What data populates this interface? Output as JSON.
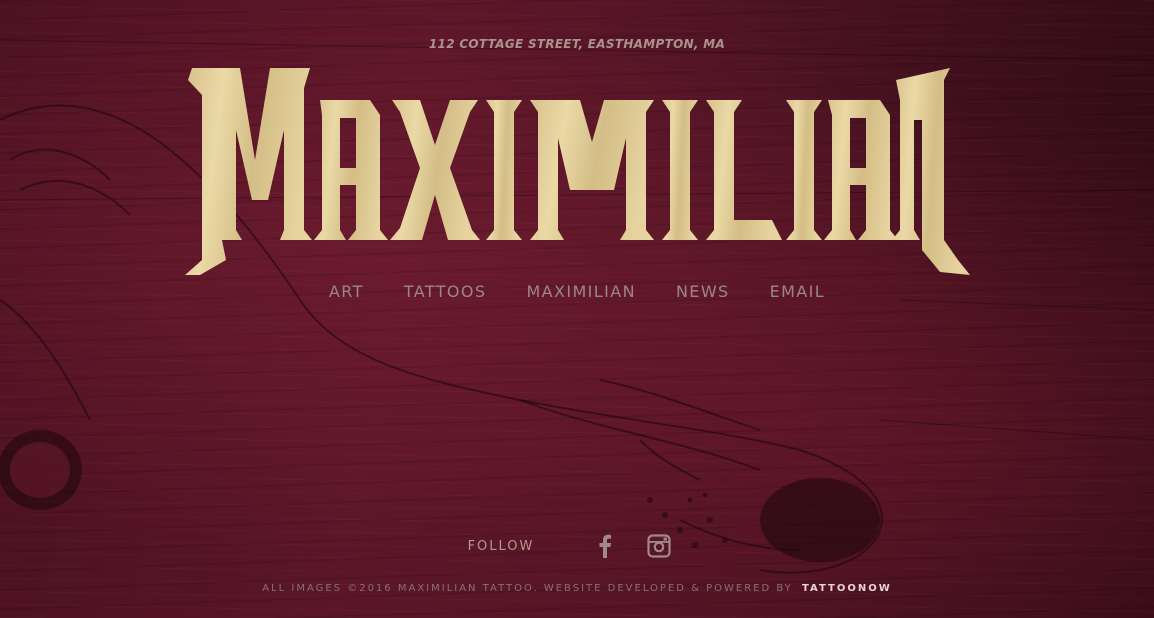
{
  "header": {
    "address": "112 COTTAGE STREET, EASTHAMPTON, MA",
    "logo_text": "Maximilian"
  },
  "nav": {
    "items": [
      "ART",
      "TATTOOS",
      "MAXIMILIAN",
      "NEWS",
      "EMAIL"
    ]
  },
  "follow": {
    "label": "FOLLOW",
    "icons": [
      "facebook-icon",
      "instagram-icon"
    ]
  },
  "footer": {
    "text": "ALL IMAGES ©2016 MAXIMILIAN TATTOO. WEBSITE DEVELOPED & POWERED BY",
    "brand": "TATTOONOW"
  },
  "colors": {
    "background": "#4a1121",
    "logo": "#e2d099",
    "nav_text": "#9b8783"
  }
}
